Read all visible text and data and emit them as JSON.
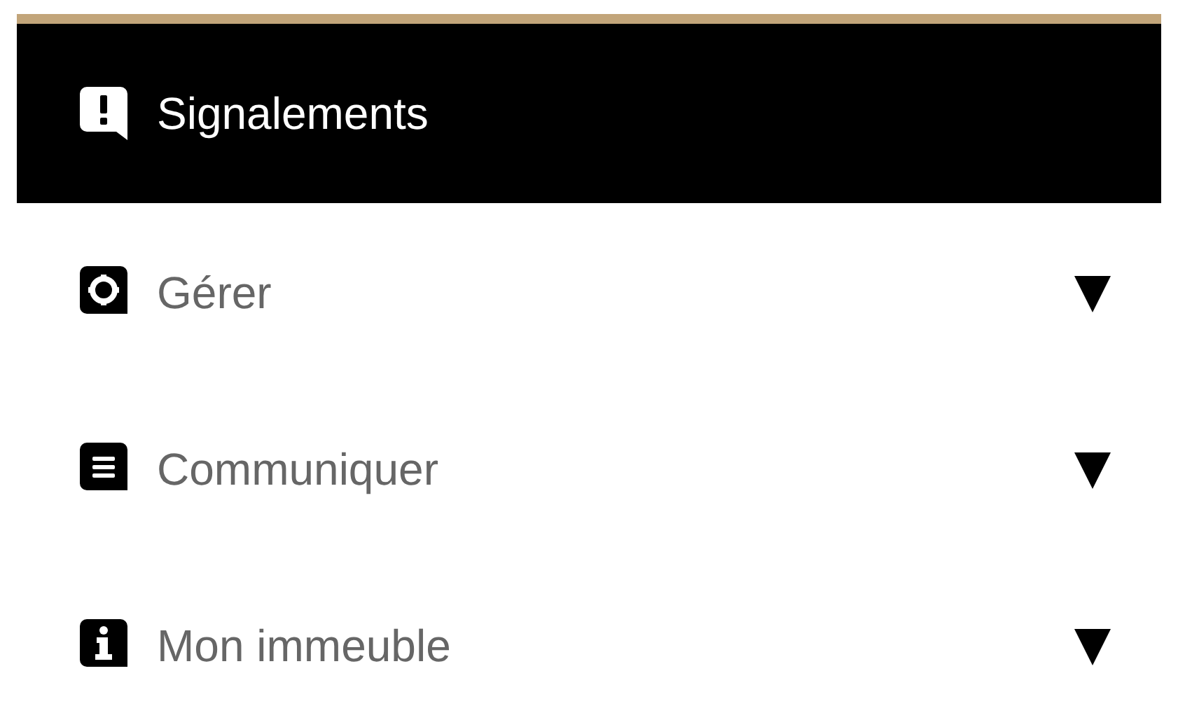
{
  "menu": {
    "items": [
      {
        "label": "Signalements",
        "kind": "link",
        "selected": true
      },
      {
        "label": "Gérer",
        "kind": "group",
        "selected": false,
        "expanded": false
      },
      {
        "label": "Communiquer",
        "kind": "group",
        "selected": false,
        "expanded": false
      },
      {
        "label": "Mon immeuble",
        "kind": "group",
        "selected": false,
        "expanded": false
      }
    ]
  }
}
